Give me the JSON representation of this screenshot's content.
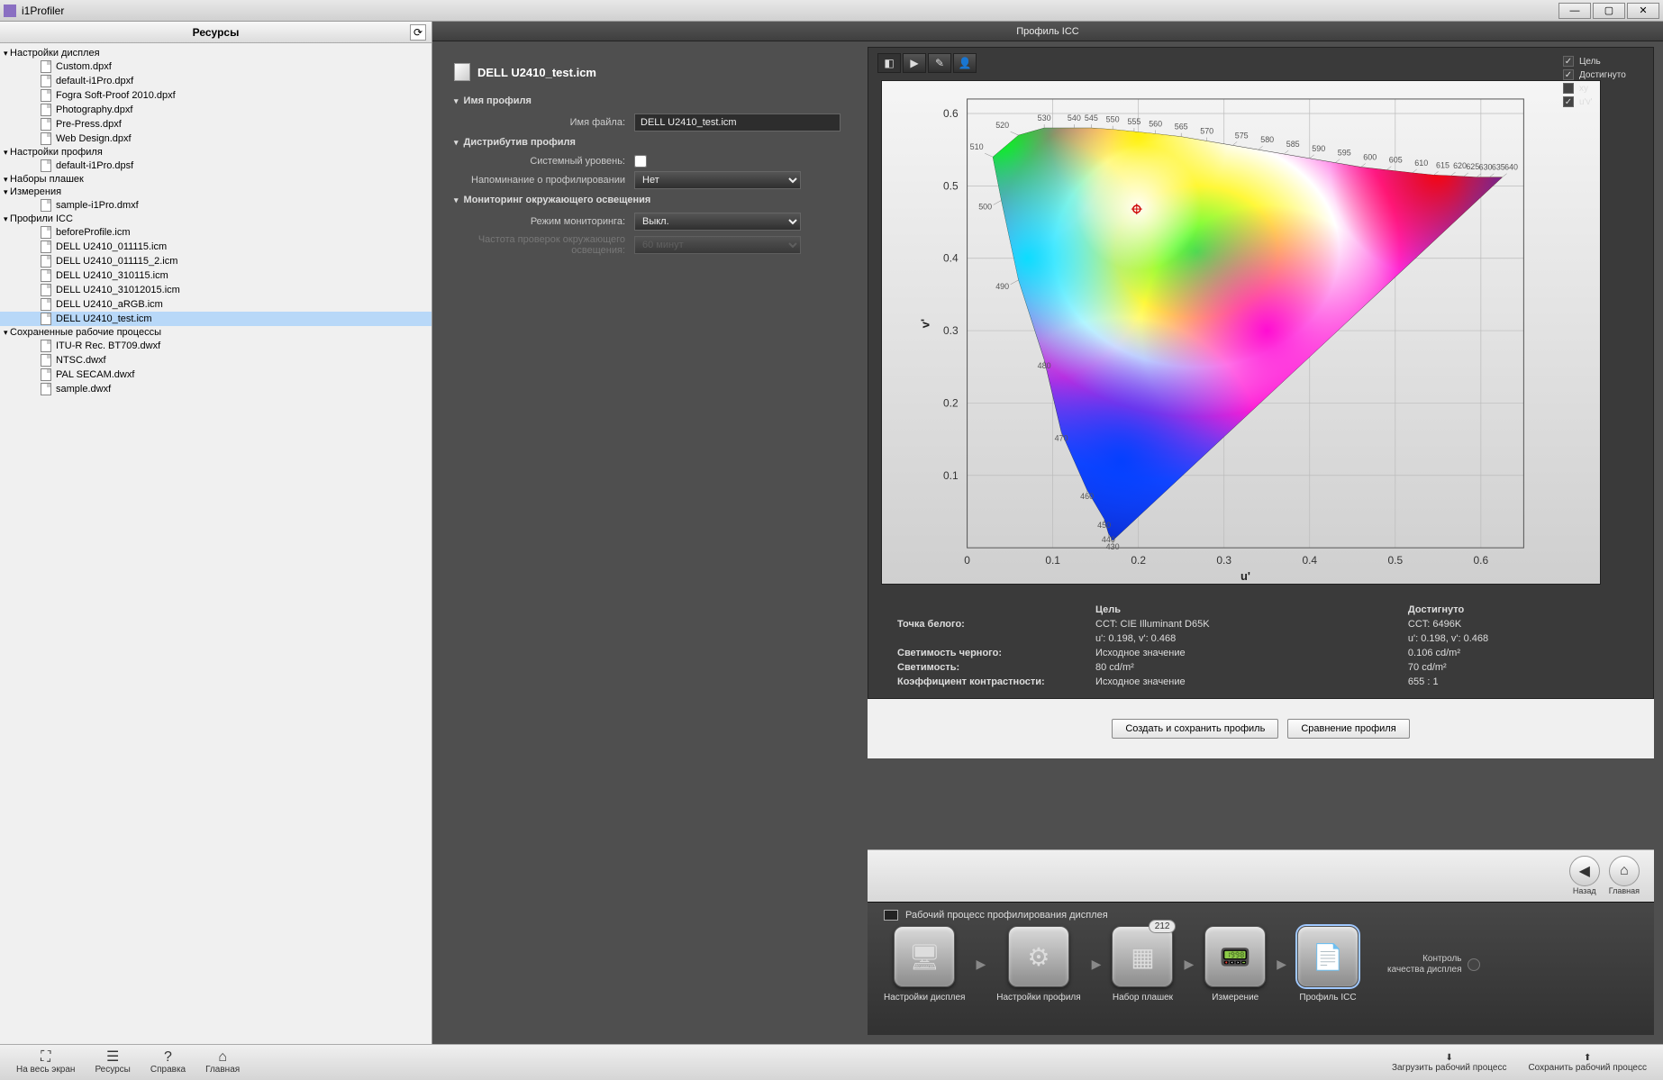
{
  "app_title": "i1Profiler",
  "sidebar": {
    "title": "Ресурсы",
    "sections": [
      {
        "label": "Настройки дисплея",
        "items": [
          "Custom.dpxf",
          "default-i1Pro.dpxf",
          "Fogra Soft-Proof 2010.dpxf",
          "Photography.dpxf",
          "Pre-Press.dpxf",
          "Web Design.dpxf"
        ]
      },
      {
        "label": "Настройки профиля",
        "items": [
          "default-i1Pro.dpsf"
        ]
      },
      {
        "label": "Наборы плашек",
        "items": []
      },
      {
        "label": "Измерения",
        "items": [
          "sample-i1Pro.dmxf"
        ]
      },
      {
        "label": "Профили ICC",
        "items": [
          "beforeProfile.icm",
          "DELL U2410_011115.icm",
          "DELL U2410_011115_2.icm",
          "DELL U2410_310115.icm",
          "DELL U2410_31012015.icm",
          "DELL U2410_aRGB.icm",
          "DELL U2410_test.icm"
        ]
      },
      {
        "label": "Сохраненные рабочие процессы",
        "items": [
          "ITU-R Rec. BT709.dwxf",
          "NTSC.dwxf",
          "PAL SECAM.dwxf",
          "sample.dwxf"
        ]
      }
    ],
    "selected": "DELL U2410_test.icm"
  },
  "content": {
    "header": "Профиль ICC",
    "profile_name": "DELL U2410_test.icm",
    "sections": {
      "name": "Имя профиля",
      "file_label": "Имя файла:",
      "file_value": "DELL U2410_test.icm",
      "dist": "Дистрибутив профиля",
      "system_level": "Системный уровень:",
      "reminder_label": "Напоминание о профилировании",
      "reminder_value": "Нет",
      "monitoring": "Мониторинг окружающего освещения",
      "mode_label": "Режим мониторинга:",
      "mode_value": "Выкл.",
      "freq_label": "Частота проверок окружающего освещения:",
      "freq_value": "60 минут"
    }
  },
  "viz": {
    "options": [
      "Цель",
      "Достигнуто",
      "xy",
      "u'v'"
    ],
    "option_states": [
      true,
      true,
      false,
      true
    ]
  },
  "chart_data": {
    "type": "area",
    "title": "",
    "xlabel": "u'",
    "ylabel": "v'",
    "xlim": [
      0,
      0.65
    ],
    "ylim": [
      0,
      0.62
    ],
    "x_ticks": [
      0,
      0.1,
      0.2,
      0.3,
      0.4,
      0.5,
      0.6
    ],
    "y_ticks": [
      0.1,
      0.2,
      0.3,
      0.4,
      0.5,
      0.6
    ],
    "spectral_locus_nm": [
      430,
      440,
      450,
      460,
      470,
      480,
      490,
      500,
      510,
      520,
      530,
      540,
      545,
      550,
      555,
      560,
      565,
      570,
      575,
      580,
      585,
      590,
      595,
      600,
      605,
      610,
      615,
      620,
      625,
      630,
      635,
      640
    ],
    "spectral_locus_uv": [
      [
        0.17,
        0.01
      ],
      [
        0.165,
        0.02
      ],
      [
        0.16,
        0.04
      ],
      [
        0.14,
        0.08
      ],
      [
        0.11,
        0.16
      ],
      [
        0.09,
        0.26
      ],
      [
        0.06,
        0.37
      ],
      [
        0.04,
        0.48
      ],
      [
        0.03,
        0.54
      ],
      [
        0.06,
        0.57
      ],
      [
        0.09,
        0.58
      ],
      [
        0.125,
        0.58
      ],
      [
        0.145,
        0.58
      ],
      [
        0.17,
        0.578
      ],
      [
        0.195,
        0.575
      ],
      [
        0.22,
        0.572
      ],
      [
        0.25,
        0.568
      ],
      [
        0.28,
        0.562
      ],
      [
        0.31,
        0.556
      ],
      [
        0.34,
        0.55
      ],
      [
        0.37,
        0.544
      ],
      [
        0.4,
        0.538
      ],
      [
        0.43,
        0.532
      ],
      [
        0.46,
        0.526
      ],
      [
        0.49,
        0.522
      ],
      [
        0.52,
        0.518
      ],
      [
        0.545,
        0.515
      ],
      [
        0.565,
        0.514
      ],
      [
        0.58,
        0.513
      ],
      [
        0.595,
        0.512
      ],
      [
        0.61,
        0.512
      ],
      [
        0.625,
        0.512
      ]
    ],
    "white_point_uv": [
      0.198,
      0.468
    ]
  },
  "table": {
    "rows_label": [
      "Точка белого:",
      "",
      "Светимость черного:",
      "Светимость:",
      "Коэффициент контрастности:"
    ],
    "col_target": "Цель",
    "col_achieved": "Достигнуто",
    "target": [
      "CCT: CIE Illuminant D65K",
      "u': 0.198, v': 0.468",
      "Исходное значение",
      "80 cd/m²",
      "Исходное значение"
    ],
    "achieved": [
      "CCT: 6496K",
      "u': 0.198, v': 0.468",
      "0.106 cd/m²",
      "70 cd/m²",
      "655 : 1"
    ]
  },
  "buttons": {
    "save": "Создать и сохранить профиль",
    "compare": "Сравнение профиля"
  },
  "nav": {
    "back": "Назад",
    "home": "Главная"
  },
  "workflow": {
    "title": "Рабочий процесс профилирования дисплея",
    "steps": [
      "Настройки дисплея",
      "Настройки профиля",
      "Набор плашек",
      "Измерение",
      "Профиль ICC"
    ],
    "badge": "212",
    "extra": "Контроль качества дисплея"
  },
  "bottombar": {
    "left": [
      "На весь экран",
      "Ресурсы",
      "Справка",
      "Главная"
    ],
    "right": [
      "Загрузить рабочий процесс",
      "Сохранить рабочий процесс"
    ]
  }
}
